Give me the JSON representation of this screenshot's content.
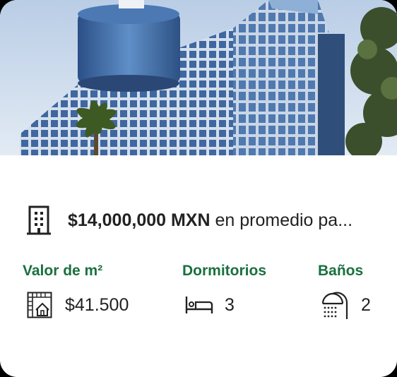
{
  "hero_image": {
    "subject": "office-tower-photo"
  },
  "price": {
    "amount": "$14,000,000 MXN",
    "suffix": "en promedio pa..."
  },
  "stats": {
    "area_price": {
      "label": "Valor de m²",
      "value": "$41.500",
      "icon": "floorplan-icon"
    },
    "bedrooms": {
      "label": "Dormitorios",
      "value": "3",
      "icon": "bed-icon"
    },
    "bathrooms": {
      "label": "Baños",
      "value": "2",
      "icon": "shower-icon"
    }
  },
  "colors": {
    "accent_green": "#1a7040",
    "text_dark": "#222222",
    "background": "#ffffff"
  }
}
